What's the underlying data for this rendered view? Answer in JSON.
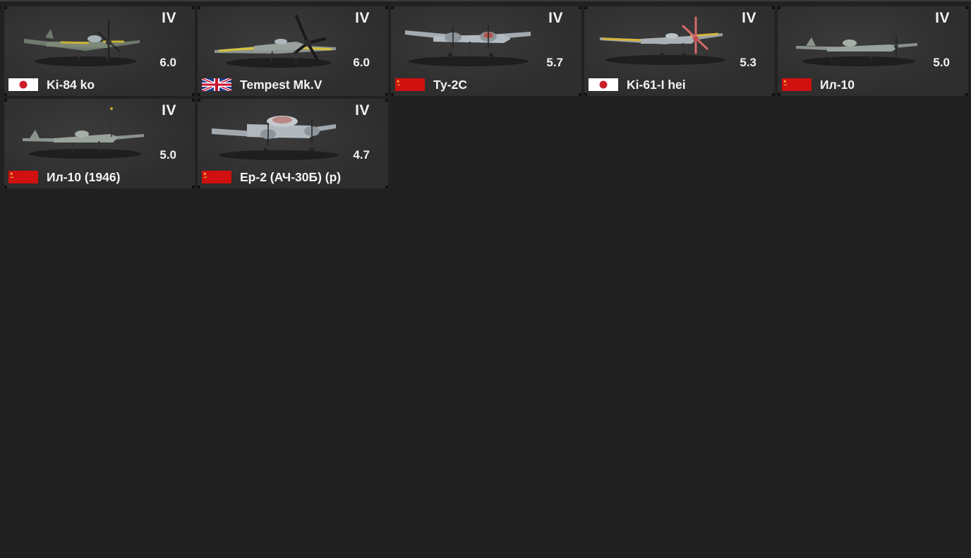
{
  "vehicles": [
    {
      "rank": "IV",
      "battle_rating": "6.0",
      "name": "Ki-84 ko",
      "flag": "japan-flag-icon",
      "plane_type": "single"
    },
    {
      "rank": "IV",
      "battle_rating": "6.0",
      "name": "Tempest Mk.V",
      "flag": "uk-flag-icon",
      "plane_type": "single"
    },
    {
      "rank": "IV",
      "battle_rating": "5.7",
      "name": "Ту-2С",
      "flag": "ussr-flag-icon",
      "plane_type": "twin"
    },
    {
      "rank": "IV",
      "battle_rating": "5.3",
      "name": "Ki-61-I hei",
      "flag": "japan-flag-icon",
      "plane_type": "single"
    },
    {
      "rank": "IV",
      "battle_rating": "5.0",
      "name": "Ил-10",
      "flag": "ussr-flag-icon",
      "plane_type": "single"
    },
    {
      "rank": "IV",
      "battle_rating": "5.0",
      "name": "Ил-10 (1946)",
      "flag": "ussr-flag-icon",
      "plane_type": "single"
    },
    {
      "rank": "IV",
      "battle_rating": "4.7",
      "name": "Ер-2 (АЧ-30Б) (р)",
      "flag": "ussr-flag-icon",
      "plane_type": "twin"
    }
  ],
  "colors": {
    "background": "#212121",
    "card": "#2e2e2e",
    "text": "#f2f2f2",
    "japan_red": "#cc1f2a",
    "ussr_red": "#d0110f",
    "uk_blue": "#1f3a8a"
  }
}
